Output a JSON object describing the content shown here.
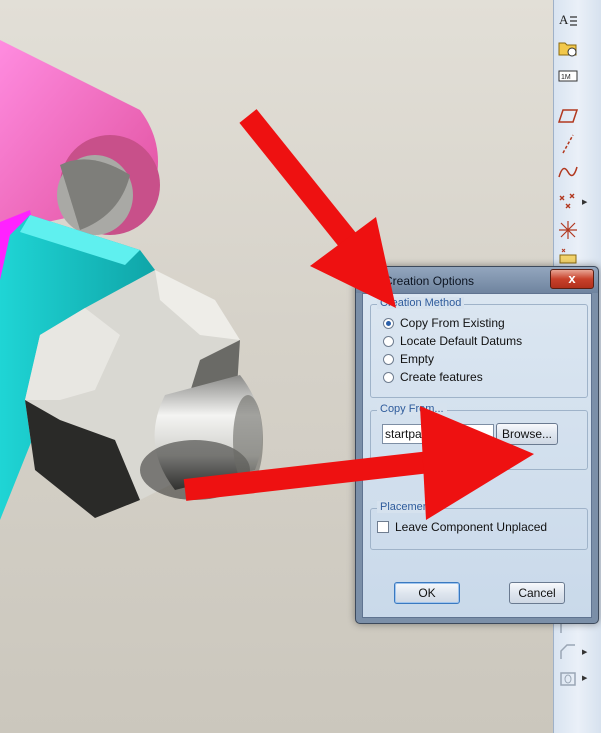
{
  "dialog": {
    "title": "Creation Options",
    "close_glyph": "x",
    "creation_method": {
      "legend": "Creation Method",
      "options": [
        {
          "label": "Copy From Existing",
          "selected": true
        },
        {
          "label": "Locate Default Datums",
          "selected": false
        },
        {
          "label": "Empty",
          "selected": false
        },
        {
          "label": "Create features",
          "selected": false
        }
      ]
    },
    "copy_from": {
      "legend": "Copy From...",
      "value": "startpart.p",
      "browse_label": "Browse..."
    },
    "placement": {
      "legend": "Placement",
      "checkbox_label": "Leave Component Unplaced",
      "checked": false
    },
    "ok_label": "OK",
    "cancel_label": "Cancel"
  },
  "toolbar": {
    "icons": [
      "text-style-icon",
      "folder-view-icon",
      "zoom-fit-icon",
      "datum-plane-icon",
      "datum-axis-icon",
      "sketch-curve-icon",
      "datum-point-icon",
      "coordinate-system-icon",
      "analysis-icon",
      "round-icon",
      "chamfer-icon",
      "hole-icon"
    ]
  },
  "colors": {
    "accent_red": "#ee1111",
    "part_pink": "#f06ecb",
    "part_cyan": "#19c8c8",
    "legend_blue": "#2f5c9c"
  }
}
